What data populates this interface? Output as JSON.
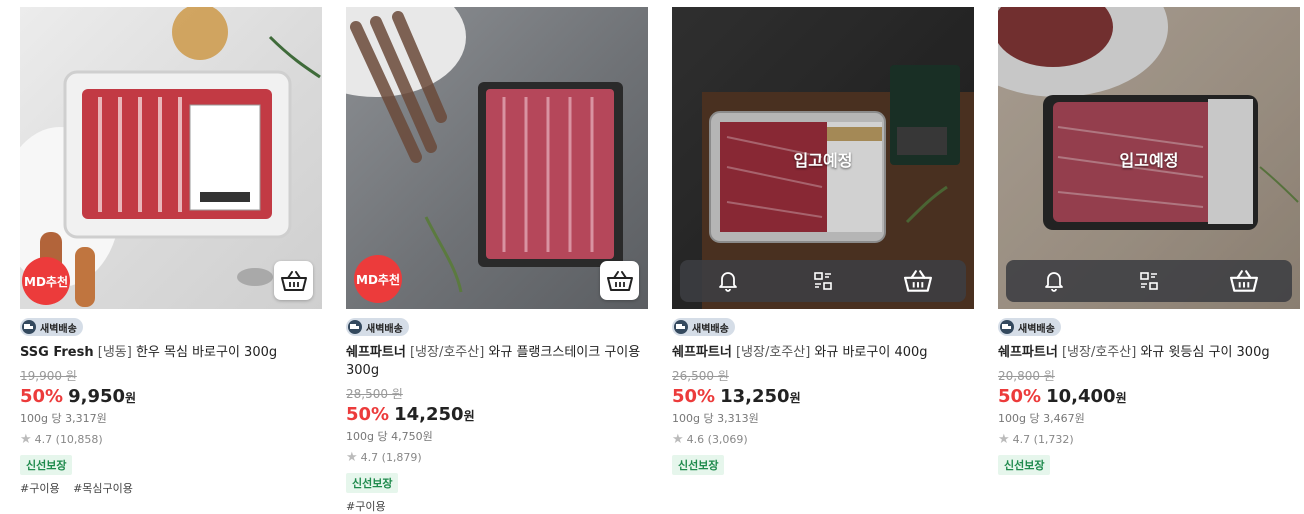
{
  "products": [
    {
      "badge": "MD추천",
      "delivery": "새벽배송",
      "brand": "SSG Fresh",
      "option": "[냉동]",
      "name": "한우 목심 바로구이 300g",
      "original_price": "19,900 원",
      "discount": "50%",
      "price": "9,950",
      "currency": "원",
      "unit_price": "100g 당 3,317원",
      "rating": "4.7 (10,858)",
      "fresh": "신선보장",
      "tags": [
        "#구이용",
        "#목심구이용"
      ]
    },
    {
      "badge": "MD추천",
      "delivery": "새벽배송",
      "brand": "쉐프파트너",
      "option": "[냉장/호주산]",
      "name": "와규 플랭크스테이크 구이용 300g",
      "original_price": "28,500 원",
      "discount": "50%",
      "price": "14,250",
      "currency": "원",
      "unit_price": "100g 당 4,750원",
      "rating": "4.7 (1,879)",
      "fresh": "신선보장",
      "tags": [
        "#구이용"
      ]
    },
    {
      "status": "입고예정",
      "delivery": "새벽배송",
      "brand": "쉐프파트너",
      "option": "[냉장/호주산]",
      "name": "와규 바로구이 400g",
      "original_price": "26,500 원",
      "discount": "50%",
      "price": "13,250",
      "currency": "원",
      "unit_price": "100g 당 3,313원",
      "rating": "4.6 (3,069)",
      "fresh": "신선보장"
    },
    {
      "status": "입고예정",
      "delivery": "새벽배송",
      "brand": "쉐프파트너",
      "option": "[냉장/호주산]",
      "name": "와규 윗등심 구이 300g",
      "original_price": "20,800 원",
      "discount": "50%",
      "price": "10,400",
      "currency": "원",
      "unit_price": "100g 당 3,467원",
      "rating": "4.7 (1,732)",
      "fresh": "신선보장"
    }
  ],
  "icons": {
    "cart": "basket-icon",
    "bell": "bell-icon",
    "compare": "compare-icon",
    "truck": "truck-icon",
    "star": "star-icon"
  },
  "colors": {
    "accent_red": "#ec3b3b",
    "fresh_green": "#1e8a4c",
    "fresh_bg": "#e6f6ec",
    "delivery_bg": "#d5dde7"
  }
}
